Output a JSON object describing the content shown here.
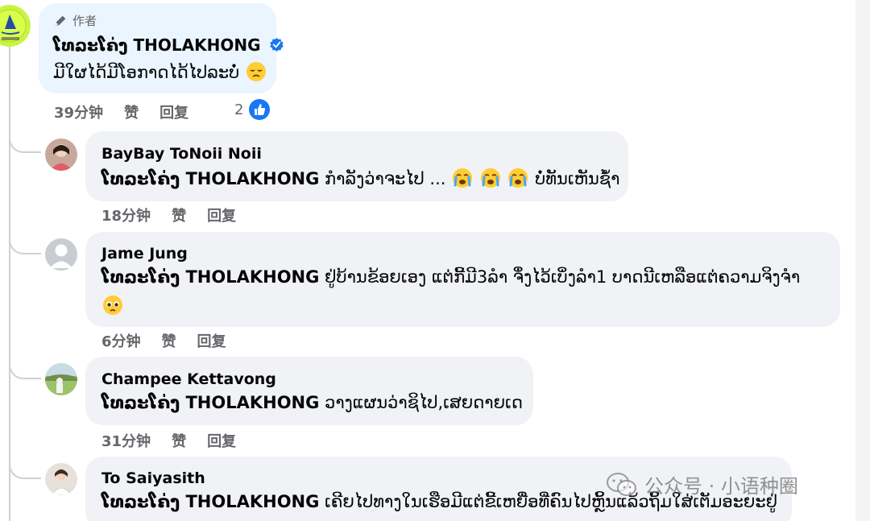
{
  "comments": [
    {
      "author_badge": "作者",
      "name": "ໂທລະໂຄ່ງ THOLAKHONG",
      "text": "ມີໃຜໄດ້ມີໂອກາດໄດ້ໄປລະບໍ່",
      "time": "39分钟",
      "like_label": "赞",
      "reply_label": "回复",
      "like_count": "2"
    },
    {
      "name": "BayBay ToNoii Noii",
      "mention": "ໂທລະໂຄ່ງ THOLAKHONG",
      "text": "ກຳລັງວ່າຈະໄປ ...",
      "text_after": "ບໍ່ທັນເຫັນຊ້ຳ",
      "time": "18分钟",
      "like_label": "赞",
      "reply_label": "回复"
    },
    {
      "name": "Jame Jung",
      "mention": "ໂທລະໂຄ່ງ THOLAKHONG",
      "text": "ຢູ່ບ້ານຂ້ອຍເອງ ແຕ່ກີ້ມີ3ລຳ ຈຶ່ງໄວ້ເບິ່ງລຳ1 ບາດນີເຫລືອແຕ່ຄວາມຈິງຈຳ",
      "time": "6分钟",
      "like_label": "赞",
      "reply_label": "回复"
    },
    {
      "name": "Champee Kettavong",
      "mention": "ໂທລະໂຄ່ງ THOLAKHONG",
      "text": "ວາງແຜນວ່າຊິໄປ,ເສຍດາຍເດ",
      "time": "31分钟",
      "like_label": "赞",
      "reply_label": "回复"
    },
    {
      "name": "To Saiyasith",
      "mention": "ໂທລະໂຄ່ງ THOLAKHONG",
      "text": "ເຄີຍໄປທາງໃນເຮືອມີແຕ່ຂີ້ເຫຍື່ອທີ່ຄົນໄປຫຼິ້ນແລ້ວຖິ້ມໃສ່ເຕັມອະຍະຢູ່"
    }
  ],
  "watermark": {
    "text": "公众号 · 小语种圈"
  },
  "icons": {
    "pencil": "pencil-icon",
    "verified": "verified-badge-icon",
    "like": "like-thumb-icon",
    "wechat": "wechat-icon"
  },
  "colors": {
    "accent": "#1877f2",
    "author_bubble": "#ebf5ff",
    "bubble": "#f0f2f5",
    "meta_text": "#65676b"
  }
}
